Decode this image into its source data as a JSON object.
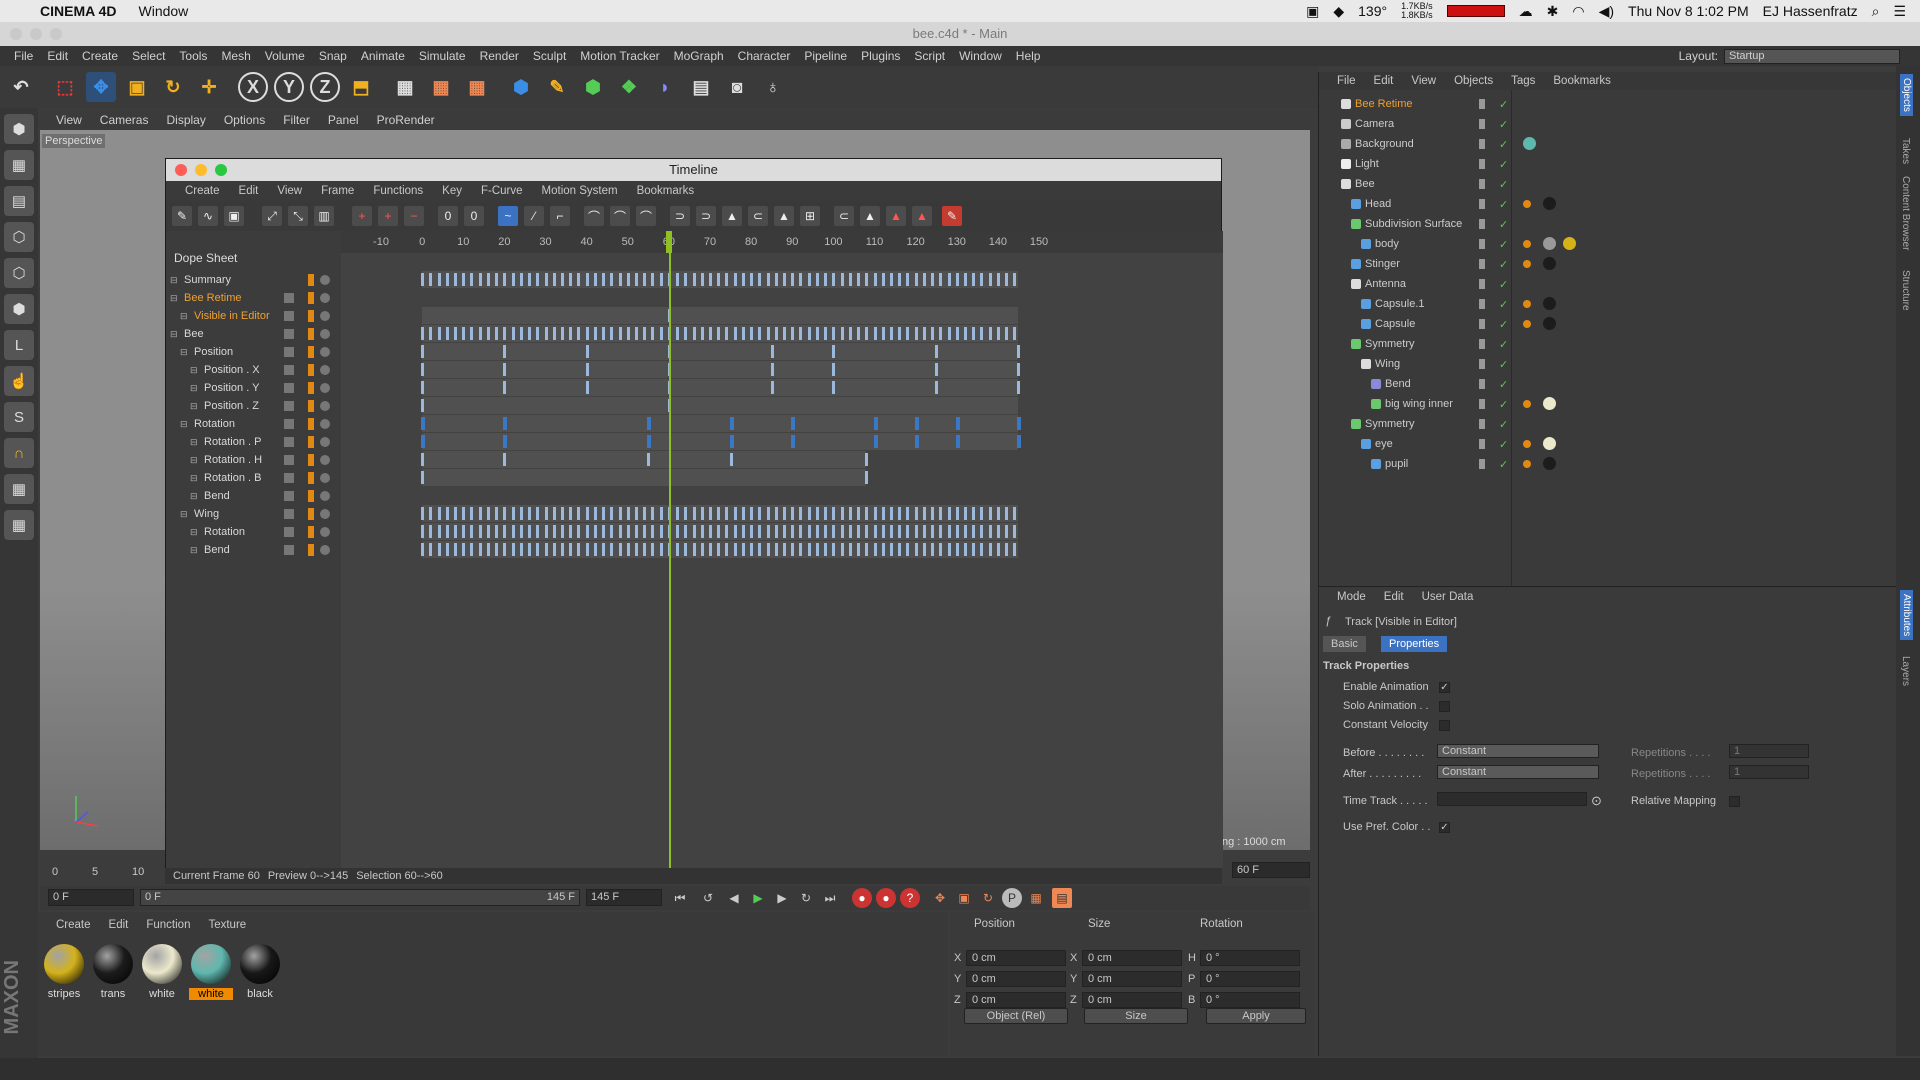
{
  "macbar": {
    "app": "CINEMA 4D",
    "menu": "Window",
    "temp": "139°",
    "net_up": "1.7KB/s",
    "net_down": "1.8KB/s",
    "datetime": "Thu Nov 8  1:02 PM",
    "user": "EJ Hassenfratz"
  },
  "window_title": "bee.c4d * - Main",
  "menu": [
    "File",
    "Edit",
    "Create",
    "Select",
    "Tools",
    "Mesh",
    "Volume",
    "Snap",
    "Animate",
    "Simulate",
    "Render",
    "Sculpt",
    "Motion Tracker",
    "MoGraph",
    "Character",
    "Pipeline",
    "Plugins",
    "Script",
    "Window",
    "Help"
  ],
  "layout": {
    "label": "Layout:",
    "value": "Startup"
  },
  "viewport": {
    "menu": [
      "View",
      "Cameras",
      "Display",
      "Options",
      "Filter",
      "Panel",
      "ProRender"
    ],
    "label": "Perspective",
    "status": "ng : 1000 cm"
  },
  "timeline": {
    "title": "Timeline",
    "menu": [
      "Create",
      "Edit",
      "View",
      "Frame",
      "Functions",
      "Key",
      "F-Curve",
      "Motion System",
      "Bookmarks"
    ],
    "panel_title": "Dope Sheet",
    "ruler": [
      "-10",
      "0",
      "10",
      "20",
      "30",
      "40",
      "50",
      "60",
      "70",
      "80",
      "90",
      "100",
      "110",
      "120",
      "130",
      "140",
      "150"
    ],
    "current_frame": 60,
    "rows": [
      {
        "name": "Summary",
        "indent": 0,
        "color": "#d8d8d8"
      },
      {
        "name": "Bee Retime",
        "indent": 0,
        "color": "#f0a030"
      },
      {
        "name": "Visible in Editor",
        "indent": 1,
        "color": "#f0a030"
      },
      {
        "name": "Bee",
        "indent": 0,
        "color": "#d8d8d8"
      },
      {
        "name": "Position",
        "indent": 1,
        "color": "#d8d8d8"
      },
      {
        "name": "Position . X",
        "indent": 2,
        "color": "#d8d8d8"
      },
      {
        "name": "Position . Y",
        "indent": 2,
        "color": "#d8d8d8"
      },
      {
        "name": "Position . Z",
        "indent": 2,
        "color": "#d8d8d8"
      },
      {
        "name": "Rotation",
        "indent": 1,
        "color": "#d8d8d8"
      },
      {
        "name": "Rotation . P",
        "indent": 2,
        "color": "#d8d8d8"
      },
      {
        "name": "Rotation . H",
        "indent": 2,
        "color": "#d8d8d8"
      },
      {
        "name": "Rotation . B",
        "indent": 2,
        "color": "#d8d8d8"
      },
      {
        "name": "Bend",
        "indent": 2,
        "color": "#d8d8d8"
      },
      {
        "name": "Wing",
        "indent": 1,
        "color": "#d8d8d8"
      },
      {
        "name": "Rotation",
        "indent": 2,
        "color": "#d8d8d8"
      },
      {
        "name": "Bend",
        "indent": 2,
        "color": "#d8d8d8"
      }
    ],
    "status": {
      "current": "Current Frame  60",
      "preview": "Preview  0-->145",
      "selection": "Selection 60-->60"
    }
  },
  "transport": {
    "start": "0 F",
    "preview_start": "0 F",
    "preview_end": "145 F",
    "end": "145 F",
    "frame": "60 F"
  },
  "ruler_bottom": [
    "0",
    "5",
    "10"
  ],
  "materials": {
    "menu": [
      "Create",
      "Edit",
      "Function",
      "Texture"
    ],
    "items": [
      {
        "name": "stripes",
        "color": "#d4b21a",
        "sel": false
      },
      {
        "name": "trans",
        "color": "#1c1c1c",
        "sel": false
      },
      {
        "name": "white",
        "color": "#ece8cc",
        "sel": false
      },
      {
        "name": "white",
        "color": "#5fb8ae",
        "sel": true
      },
      {
        "name": "black",
        "color": "#181818",
        "sel": false
      }
    ]
  },
  "coords": {
    "headers": [
      "Position",
      "Size",
      "Rotation"
    ],
    "rows": [
      {
        "a": "X",
        "pv": "0 cm",
        "b": "X",
        "sv": "0 cm",
        "c": "H",
        "rv": "0 °"
      },
      {
        "a": "Y",
        "pv": "0 cm",
        "b": "Y",
        "sv": "0 cm",
        "c": "P",
        "rv": "0 °"
      },
      {
        "a": "Z",
        "pv": "0 cm",
        "b": "Z",
        "sv": "0 cm",
        "c": "B",
        "rv": "0 °"
      }
    ],
    "mode": "Object (Rel)",
    "size_mode": "Size",
    "apply": "Apply"
  },
  "objects": {
    "menu": [
      "File",
      "Edit",
      "View",
      "Objects",
      "Tags",
      "Bookmarks"
    ],
    "items": [
      {
        "name": "Bee Retime",
        "indent": 0,
        "color": "#f0a030",
        "icon": "#ddd",
        "tags": []
      },
      {
        "name": "Camera",
        "indent": 0,
        "color": "#ccc",
        "icon": "#ccc",
        "tags": []
      },
      {
        "name": "Background",
        "indent": 0,
        "color": "#ccc",
        "icon": "#aaa",
        "tags": [
          "#5fb8ae"
        ]
      },
      {
        "name": "Light",
        "indent": 0,
        "color": "#ccc",
        "icon": "#eee",
        "tags": []
      },
      {
        "name": "Bee",
        "indent": 0,
        "color": "#ccc",
        "icon": "#ddd",
        "tags": []
      },
      {
        "name": "Head",
        "indent": 1,
        "color": "#ccc",
        "icon": "#5aa0e0",
        "tags": [
          "#e08a14",
          "#1c1c1c"
        ]
      },
      {
        "name": "Subdivision Surface",
        "indent": 1,
        "color": "#ccc",
        "icon": "#6cc86c",
        "tags": []
      },
      {
        "name": "body",
        "indent": 2,
        "color": "#ccc",
        "icon": "#5aa0e0",
        "tags": [
          "#e08a14",
          "#999",
          "#d4b21a"
        ]
      },
      {
        "name": "Stinger",
        "indent": 1,
        "color": "#ccc",
        "icon": "#5aa0e0",
        "tags": [
          "#e08a14",
          "#1c1c1c"
        ]
      },
      {
        "name": "Antenna",
        "indent": 1,
        "color": "#ccc",
        "icon": "#ddd",
        "tags": []
      },
      {
        "name": "Capsule.1",
        "indent": 2,
        "color": "#ccc",
        "icon": "#5aa0e0",
        "tags": [
          "#e08a14",
          "#1c1c1c"
        ]
      },
      {
        "name": "Capsule",
        "indent": 2,
        "color": "#ccc",
        "icon": "#5aa0e0",
        "tags": [
          "#e08a14",
          "#1c1c1c"
        ]
      },
      {
        "name": "Symmetry",
        "indent": 1,
        "color": "#ccc",
        "icon": "#6cc86c",
        "tags": []
      },
      {
        "name": "Wing",
        "indent": 2,
        "color": "#ccc",
        "icon": "#ddd",
        "tags": []
      },
      {
        "name": "Bend",
        "indent": 3,
        "color": "#ccc",
        "icon": "#8a8ad8",
        "tags": []
      },
      {
        "name": "big wing inner",
        "indent": 3,
        "color": "#ccc",
        "icon": "#6cc86c",
        "tags": [
          "#e08a14",
          "#ece8cc"
        ]
      },
      {
        "name": "Symmetry",
        "indent": 1,
        "color": "#ccc",
        "icon": "#6cc86c",
        "tags": []
      },
      {
        "name": "eye",
        "indent": 2,
        "color": "#ccc",
        "icon": "#5aa0e0",
        "tags": [
          "#e08a14",
          "#ece8cc"
        ]
      },
      {
        "name": "pupil",
        "indent": 3,
        "color": "#ccc",
        "icon": "#5aa0e0",
        "tags": [
          "#e08a14",
          "#1c1c1c"
        ]
      }
    ]
  },
  "attributes": {
    "menu": [
      "Mode",
      "Edit",
      "User Data"
    ],
    "track": "Track [Visible in Editor]",
    "tabs": [
      "Basic",
      "Properties"
    ],
    "section": "Track Properties",
    "enable_animation": "Enable Animation",
    "solo_animation": "Solo Animation . .",
    "constant_velocity": "Constant Velocity",
    "before_label": "Before . . . . . . . .",
    "before_value": "Constant",
    "after_label": "After . . . . . . . . .",
    "after_value": "Constant",
    "repetitions_label": "Repetitions . . . .",
    "repetitions_value": "1",
    "time_track": "Time Track . . . . .",
    "relative_mapping": "Relative Mapping",
    "use_pref_color": "Use Pref. Color . ."
  },
  "right_tabs": [
    "Objects",
    "Takes",
    "Content Browser",
    "Structure",
    "Attributes",
    "Layers"
  ]
}
